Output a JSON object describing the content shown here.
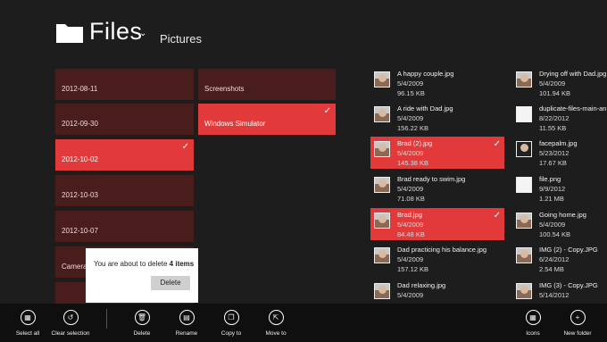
{
  "header": {
    "title": "Files",
    "breadcrumb": "Pictures"
  },
  "folders": [
    {
      "label": "2012-08-11",
      "selected": false
    },
    {
      "label": "2012-09-30",
      "selected": false
    },
    {
      "label": "2012-10-02",
      "selected": true
    },
    {
      "label": "2012-10-03",
      "selected": false
    },
    {
      "label": "2012-10-07",
      "selected": false
    },
    {
      "label": "Camera",
      "selected": false
    },
    {
      "label": "Screenshots",
      "selected": false
    },
    {
      "label": "Windows Simulator",
      "selected": true
    }
  ],
  "files_col1": [
    {
      "name": "A happy couple.jpg",
      "date": "5/4/2009",
      "size": "96.15 KB",
      "selected": false
    },
    {
      "name": "A ride with Dad.jpg",
      "date": "5/4/2009",
      "size": "156.22 KB",
      "selected": false
    },
    {
      "name": "Brad (2).jpg",
      "date": "5/4/2009",
      "size": "145.38 KB",
      "selected": true
    },
    {
      "name": "Brad ready to swim.jpg",
      "date": "5/4/2009",
      "size": "71.08 KB",
      "selected": false
    },
    {
      "name": "Brad.jpg",
      "date": "5/4/2009",
      "size": "84.48 KB",
      "selected": true
    },
    {
      "name": "Dad practicing his balance.jpg",
      "date": "5/4/2009",
      "size": "157.12 KB",
      "selected": false
    },
    {
      "name": "Dad relaxing.jpg",
      "date": "5/4/2009",
      "size": "",
      "selected": false
    }
  ],
  "files_col2": [
    {
      "name": "Drying off with Dad.jpg",
      "date": "5/4/2009",
      "size": "101.94 KB",
      "selected": false
    },
    {
      "name": "duplicate-files-main-an",
      "date": "8/22/2012",
      "size": "11.55 KB",
      "selected": false
    },
    {
      "name": "facepalm.jpg",
      "date": "5/23/2012",
      "size": "17.67 KB",
      "selected": false
    },
    {
      "name": "file.png",
      "date": "9/9/2012",
      "size": "1.21 MB",
      "selected": false
    },
    {
      "name": "Going home.jpg",
      "date": "5/4/2009",
      "size": "100.54 KB",
      "selected": false
    },
    {
      "name": "IMG (2) - Copy.JPG",
      "date": "6/24/2012",
      "size": "2.54 MB",
      "selected": false
    },
    {
      "name": "IMG (3) - Copy.JPG",
      "date": "5/14/2012",
      "size": "",
      "selected": false
    }
  ],
  "dialog": {
    "message_prefix": "You are about to delete ",
    "count": "4 items",
    "delete_label": "Delete"
  },
  "appbar": {
    "select_all": "Select all",
    "clear_selection": "Clear selection",
    "delete": "Delete",
    "rename": "Rename",
    "copy_to": "Copy to",
    "move_to": "Move to",
    "icons": "Icons",
    "new_folder": "New folder"
  },
  "colors": {
    "accent": "#e23a3a",
    "tile": "#4a1d1d",
    "background": "#1d1d1d",
    "appbar": "#0f0f0f"
  }
}
